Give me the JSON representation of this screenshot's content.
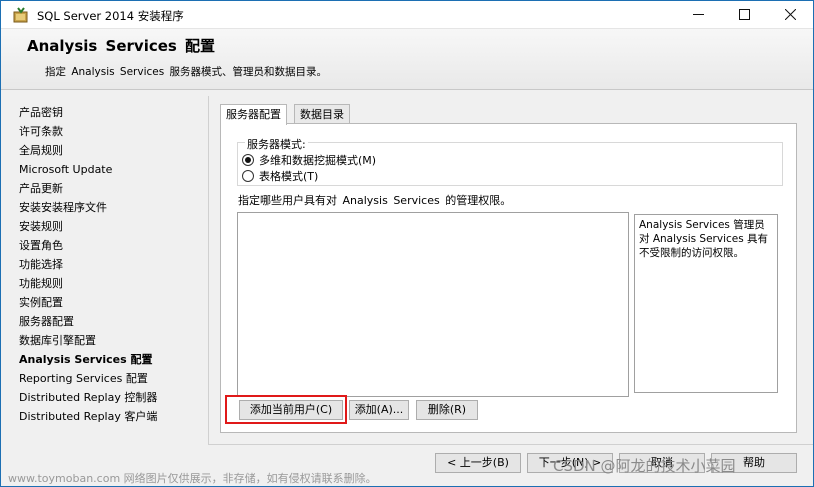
{
  "window": {
    "title": "SQL Server 2014 安装程序",
    "icon": "sql-server-setup-icon"
  },
  "header": {
    "title": "Analysis  Services 配置",
    "subtitle": "指定 Analysis  Services 服务器模式、管理员和数据目录。"
  },
  "nav": {
    "items": [
      {
        "label": "产品密钥"
      },
      {
        "label": "许可条款"
      },
      {
        "label": "全局规则"
      },
      {
        "label": "Microsoft Update"
      },
      {
        "label": "产品更新"
      },
      {
        "label": "安装安装程序文件"
      },
      {
        "label": "安装规则"
      },
      {
        "label": "设置角色"
      },
      {
        "label": "功能选择"
      },
      {
        "label": "功能规则"
      },
      {
        "label": "实例配置"
      },
      {
        "label": "服务器配置"
      },
      {
        "label": "数据库引擎配置"
      },
      {
        "label": "Analysis Services 配置",
        "active": true
      },
      {
        "label": "Reporting Services 配置"
      },
      {
        "label": "Distributed Replay 控制器"
      },
      {
        "label": "Distributed Replay 客户端"
      }
    ]
  },
  "tabs": [
    {
      "label": "服务器配置",
      "active": true
    },
    {
      "label": "数据目录",
      "active": false
    }
  ],
  "server_mode": {
    "legend": "服务器模式:",
    "options": [
      {
        "label": "多维和数据挖掘模式(M)",
        "selected": true
      },
      {
        "label": "表格模式(T)",
        "selected": false
      }
    ]
  },
  "permissions": {
    "label": "指定哪些用户具有对 Analysis Services 的管理权限。",
    "info": "Analysis Services 管理员对 Analysis Services 具有不受限制的访问权限。"
  },
  "buttons": {
    "add_current_user": "添加当前用户(C)",
    "add": "添加(A)...",
    "remove": "删除(R)",
    "back": "< 上一步(B)",
    "next": "下一步(N) >",
    "cancel": "取消",
    "help": "帮助"
  },
  "watermarks": {
    "left": "www.toymoban.com 网络图片仅供展示，非存储，如有侵权请联系删除。",
    "right": "CSDN @阿龙的技术小菜园"
  },
  "colors": {
    "highlight_border": "#e01919",
    "desktop_bg": "#1c6fb3"
  }
}
